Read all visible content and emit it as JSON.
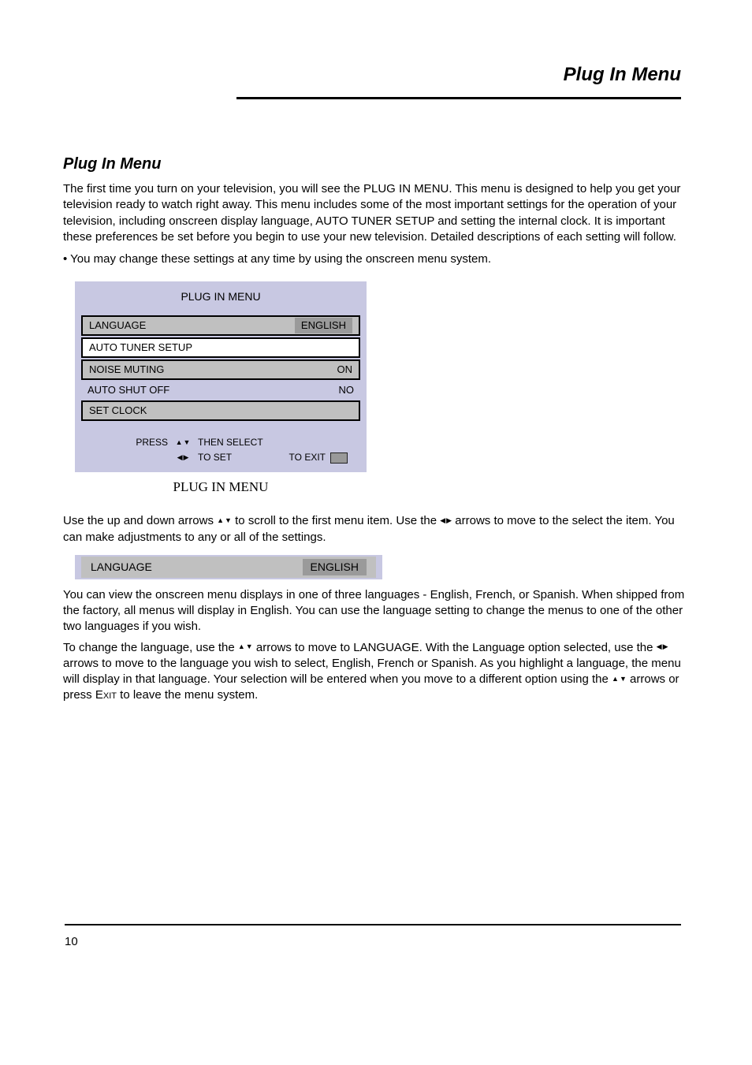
{
  "header": {
    "title": "Plug In Menu"
  },
  "section": {
    "title": "Plug In Menu",
    "intro": "The first time you turn on your television, you will see the PLUG IN MENU. This menu is designed to help you get your television ready to watch right away. This menu includes some of the most important settings for the operation of your television, including onscreen display language, AUTO TUNER SETUP and setting the internal clock. It is important these preferences be set before you begin to use your new television. Detailed descriptions of each setting will follow.",
    "bullet": "• You may change these settings at any time by using the onscreen menu system."
  },
  "osd": {
    "title": "PLUG IN MENU",
    "rows": [
      {
        "label": "LANGUAGE",
        "value": "ENGLISH"
      },
      {
        "label": "AUTO TUNER SETUP",
        "value": ""
      },
      {
        "label": "NOISE MUTING",
        "value": "ON"
      },
      {
        "label": "AUTO SHUT OFF",
        "value": "NO"
      },
      {
        "label": "SET CLOCK",
        "value": ""
      }
    ],
    "hints": {
      "press_label": "PRESS",
      "row1": "THEN SELECT",
      "row2_left": "TO SET",
      "row2_right": "TO EXIT"
    },
    "caption": "PLUG IN MENU"
  },
  "usage": {
    "p1a": "Use the up and down arrows ",
    "p1b": " to scroll to the first menu item. Use the ",
    "p1c": " arrows to move to the select the item. You can make adjustments to any or all of the settings."
  },
  "lang_row": {
    "label": "LANGUAGE",
    "value": "ENGLISH"
  },
  "lang": {
    "p1": "You can view the onscreen menu displays in one of three languages - English, French, or Spanish. When shipped from the factory, all menus will display in English. You can use the language setting to change the menus to one of the other two languages if you wish.",
    "p2a": "To change the language, use the ",
    "p2b": " arrows to move to LANGUAGE. With the Language option selected, use the ",
    "p2c": " arrows to move to the language you wish to select, English, French or Spanish. As you highlight a language, the menu will display in that language. Your selection will be entered when you move to a different option using  the ",
    "p2d": " arrows or press ",
    "p2e": " to leave the menu system.",
    "exit_key": "Exit"
  },
  "footer": {
    "page": "10"
  }
}
